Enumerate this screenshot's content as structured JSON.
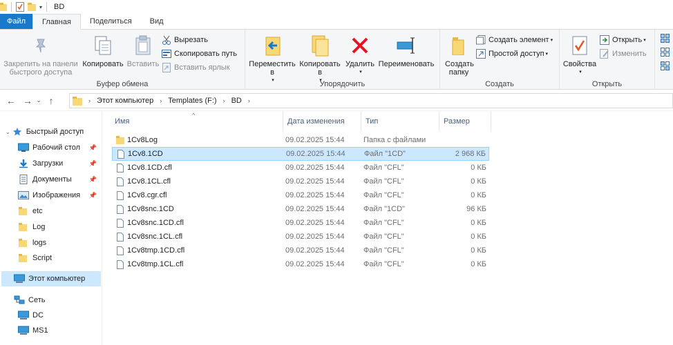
{
  "window": {
    "title": "BD"
  },
  "tabs": [
    {
      "label": "Файл"
    },
    {
      "label": "Главная"
    },
    {
      "label": "Поделиться"
    },
    {
      "label": "Вид"
    }
  ],
  "ribbon": {
    "clipboard": {
      "group_label": "Буфер обмена",
      "pin_label": "Закрепить на панели быстрого доступа",
      "copy_label": "Копировать",
      "paste_label": "Вставить",
      "cut_label": "Вырезать",
      "copy_path_label": "Скопировать путь",
      "paste_shortcut_label": "Вставить ярлык"
    },
    "organize": {
      "group_label": "Упорядочить",
      "move_label": "Переместить в",
      "copy_to_label": "Копировать в",
      "delete_label": "Удалить",
      "rename_label": "Переименовать"
    },
    "new": {
      "group_label": "Создать",
      "new_folder_label": "Создать папку",
      "new_item_label": "Создать элемент",
      "easy_access_label": "Простой доступ"
    },
    "open": {
      "group_label": "Открыть",
      "properties_label": "Свойства",
      "open_label": "Открыть",
      "edit_label": "Изменить"
    }
  },
  "address": {
    "crumbs": [
      "Этот компьютер",
      "Templates (F:)",
      "BD"
    ]
  },
  "nav": {
    "quick_access": "Быстрый доступ",
    "items": [
      {
        "label": "Рабочий стол",
        "icon": "desktop-icon",
        "pinned": true
      },
      {
        "label": "Загрузки",
        "icon": "downloads-icon",
        "pinned": true
      },
      {
        "label": "Документы",
        "icon": "documents-icon",
        "pinned": true
      },
      {
        "label": "Изображения",
        "icon": "pictures-icon",
        "pinned": true
      },
      {
        "label": "etc",
        "icon": "folder-icon",
        "pinned": false
      },
      {
        "label": "Log",
        "icon": "folder-icon",
        "pinned": false
      },
      {
        "label": "logs",
        "icon": "folder-icon",
        "pinned": false
      },
      {
        "label": "Script",
        "icon": "folder-icon",
        "pinned": false
      }
    ],
    "this_pc": "Этот компьютер",
    "network": "Сеть",
    "network_items": [
      "DC",
      "MS1"
    ]
  },
  "columns": {
    "name": "Имя",
    "date": "Дата изменения",
    "type": "Тип",
    "size": "Размер"
  },
  "files": [
    {
      "name": "1Cv8Log",
      "date": "09.02.2025 15:44",
      "type": "Папка с файлами",
      "size": "",
      "kind": "folder"
    },
    {
      "name": "1Cv8.1CD",
      "date": "09.02.2025 15:44",
      "type": "Файл \"1CD\"",
      "size": "2 968 КБ",
      "kind": "file"
    },
    {
      "name": "1Cv8.1CD.cfl",
      "date": "09.02.2025 15:44",
      "type": "Файл \"CFL\"",
      "size": "0 КБ",
      "kind": "file"
    },
    {
      "name": "1Cv8.1CL.cfl",
      "date": "09.02.2025 15:44",
      "type": "Файл \"CFL\"",
      "size": "0 КБ",
      "kind": "file"
    },
    {
      "name": "1Cv8.cgr.cfl",
      "date": "09.02.2025 15:44",
      "type": "Файл \"CFL\"",
      "size": "0 КБ",
      "kind": "file"
    },
    {
      "name": "1Cv8snc.1CD",
      "date": "09.02.2025 15:44",
      "type": "Файл \"1CD\"",
      "size": "96 КБ",
      "kind": "file"
    },
    {
      "name": "1Cv8snc.1CD.cfl",
      "date": "09.02.2025 15:44",
      "type": "Файл \"CFL\"",
      "size": "0 КБ",
      "kind": "file"
    },
    {
      "name": "1Cv8snc.1CL.cfl",
      "date": "09.02.2025 15:44",
      "type": "Файл \"CFL\"",
      "size": "0 КБ",
      "kind": "file"
    },
    {
      "name": "1Cv8tmp.1CD.cfl",
      "date": "09.02.2025 15:44",
      "type": "Файл \"CFL\"",
      "size": "0 КБ",
      "kind": "file"
    },
    {
      "name": "1Cv8tmp.1CL.cfl",
      "date": "09.02.2025 15:44",
      "type": "Файл \"CFL\"",
      "size": "0 КБ",
      "kind": "file"
    }
  ],
  "colors": {
    "file_tab": "#1979ca",
    "selection": "#cce8ff",
    "folder": "#f8d775",
    "delete": "#e81123"
  }
}
